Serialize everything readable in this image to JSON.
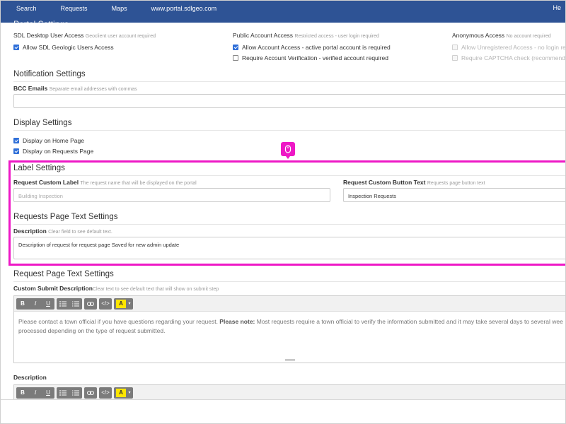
{
  "topbar": {
    "nav": [
      "Search",
      "Requests",
      "Maps",
      "www.portal.sdlgeo.com"
    ],
    "right": "He",
    "cut_title": "Portal Settings"
  },
  "access": {
    "desktop": {
      "title": "SDL Desktop User Access",
      "hint": "Geoclient user account required",
      "opt1": "Allow SDL Geologic Users Access"
    },
    "public": {
      "title": "Public Account Access",
      "hint": "Restricted access - user login required",
      "opt1": "Allow Account Access - active portal account is required",
      "opt2": "Require Account Verification - verified account required"
    },
    "anon": {
      "title": "Anonymous Access",
      "hint": "No account required",
      "opt1": "Allow Unregistered Access - no login re",
      "opt2": "Require CAPTCHA check (recommende"
    }
  },
  "notification": {
    "title": "Notification Settings",
    "bcc_label": "BCC Emails",
    "bcc_hint": "Separate email addresses with commas",
    "bcc_value": ""
  },
  "display": {
    "title": "Display Settings",
    "opt1": "Display on Home Page",
    "opt2": "Display on Requests Page"
  },
  "label_settings": {
    "title": "Label Settings",
    "custom_label": "Request Custom Label",
    "custom_label_hint": "The request name that will be displayed on the portal",
    "custom_label_placeholder": "Building Inspection",
    "button_text": "Request Custom Button Text",
    "button_text_hint": "Requests page button text",
    "button_text_value": "Inspection Requests"
  },
  "requests_page": {
    "title": "Requests Page Text Settings",
    "desc_label": "Description",
    "desc_hint": "Clear field to see default text.",
    "desc_value": "Description of request for request page Saved for new admin update"
  },
  "request_page": {
    "title": "Request Page Text Settings",
    "submit_label": "Custom Submit Description",
    "submit_hint": "Clear text to see default text that will show on submit step",
    "editor_line1_a": "Please contact a town official if you have questions regarding your request. ",
    "editor_line1_b": "Please note:",
    "editor_line1_c": " Most requests require a town official to verify the information submitted and it may take several days to several wee",
    "editor_line2": "processed depending on the type of request submitted.",
    "desc2_label": "Description"
  },
  "toolbar": {
    "bold": "B",
    "italic": "I",
    "underline": "U",
    "color": "A",
    "caret": "▾",
    "code": "</>"
  }
}
